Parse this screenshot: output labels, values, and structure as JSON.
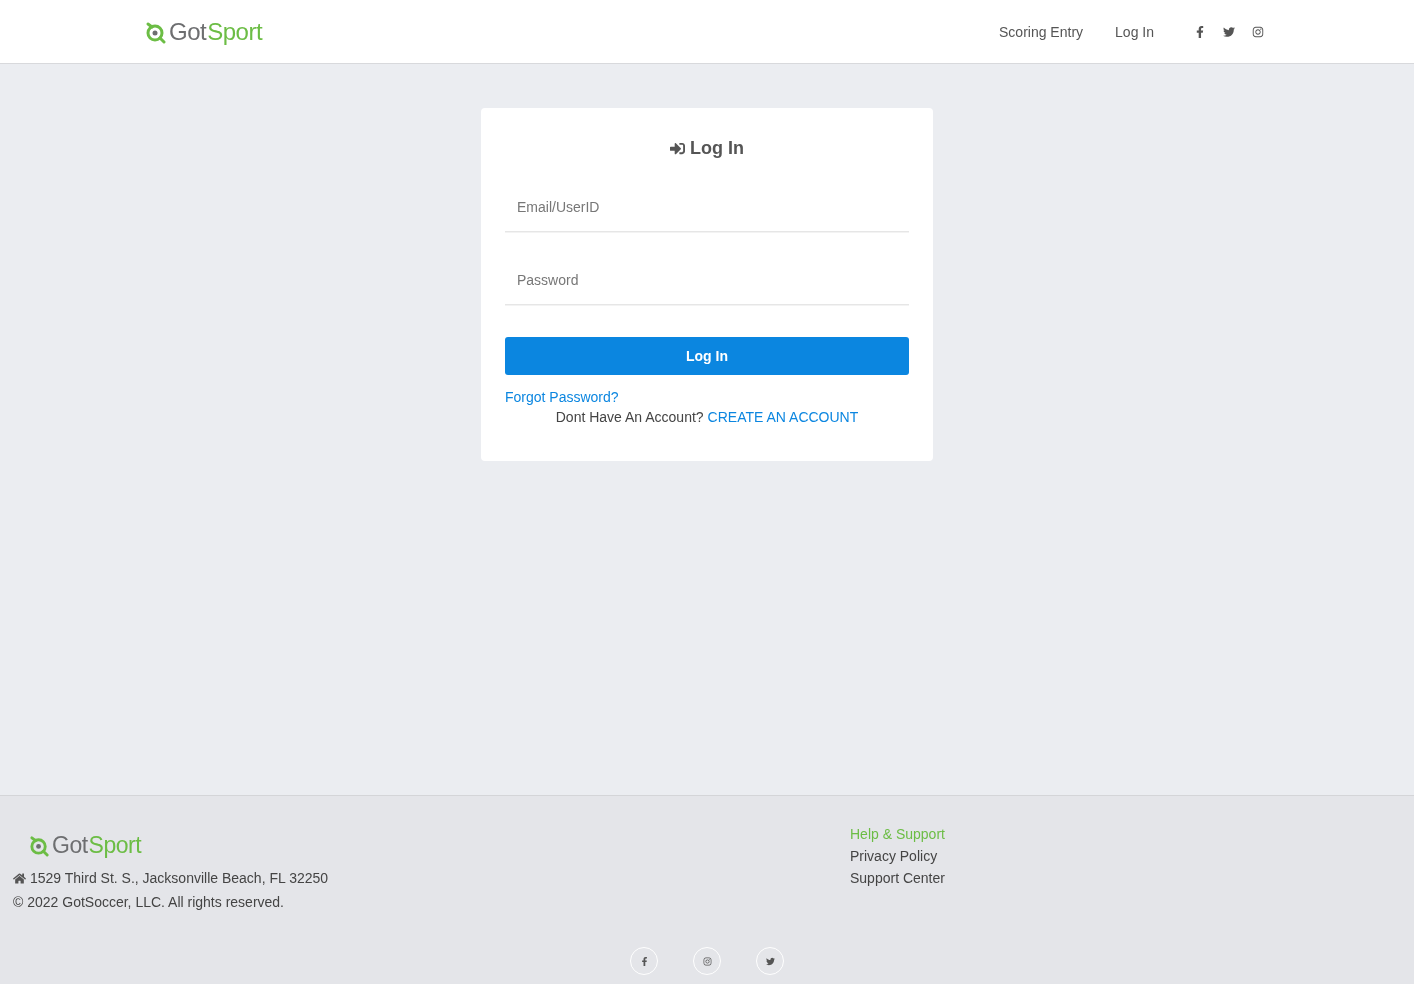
{
  "header": {
    "logo": {
      "got": "Got",
      "sport": "Sport"
    },
    "nav": [
      "Scoring Entry",
      "Log In"
    ]
  },
  "login": {
    "title": "Log In",
    "fields": [
      {
        "placeholder": "Email/UserID"
      },
      {
        "placeholder": "Password"
      }
    ],
    "submit": "Log In",
    "forgot": "Forgot Password?",
    "signup_prompt": "Dont Have An Account?",
    "signup_link": "CREATE AN ACCOUNT"
  },
  "footer": {
    "logo": {
      "got": "Got",
      "sport": "Sport"
    },
    "address": "1529 Third St. S., Jacksonville Beach, FL 32250",
    "copyright": "© 2022 GotSoccer, LLC. All rights reserved.",
    "links": [
      {
        "label": "Help & Support",
        "kind": "heading"
      },
      {
        "label": "Privacy Policy",
        "kind": "link"
      },
      {
        "label": "Support Center",
        "kind": "link"
      }
    ]
  }
}
